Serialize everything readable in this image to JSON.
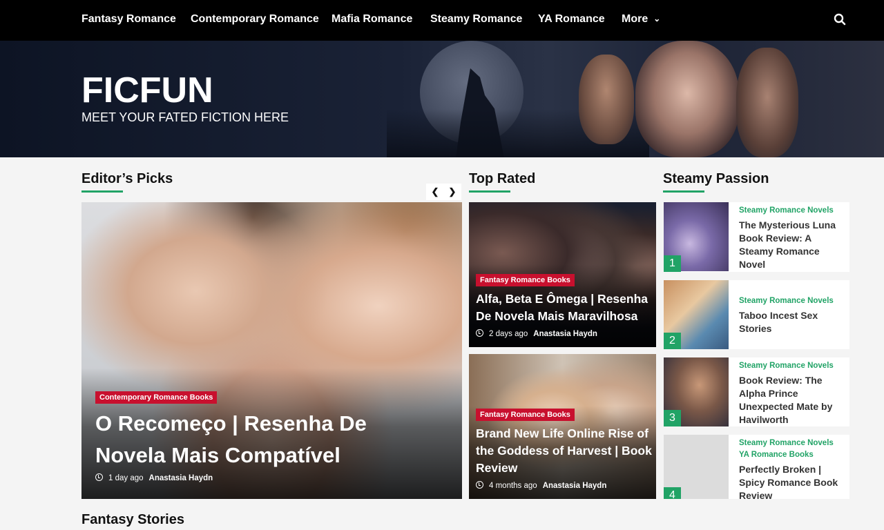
{
  "nav": {
    "items": [
      "Fantasy Romance",
      "Contemporary Romance",
      "Mafia Romance",
      "Steamy Romance",
      "YA Romance"
    ],
    "more_label": "More"
  },
  "hero": {
    "title": "FICFUN",
    "tagline": "MEET YOUR FATED FICTION HERE"
  },
  "editors_picks": {
    "heading": "Editor’s Picks",
    "card": {
      "category": "Contemporary Romance Books",
      "title": "O Recomeço | Resenha De Novela Mais Compatível",
      "time": "1 day ago",
      "author": "Anastasia Haydn"
    }
  },
  "top_rated": {
    "heading": "Top Rated",
    "cards": [
      {
        "category": "Fantasy Romance Books",
        "title": "Alfa, Beta E Ômega | Resenha De Novela Mais Maravilhosa",
        "time": "2 days ago",
        "author": "Anastasia Haydn"
      },
      {
        "category": "Fantasy Romance Books",
        "title": "Brand New Life Online Rise of the Goddess of Harvest | Book Review",
        "time": "4 months ago",
        "author": "Anastasia Haydn"
      }
    ]
  },
  "steamy_passion": {
    "heading": "Steamy Passion",
    "items": [
      {
        "rank": "1",
        "categories": [
          "Steamy Romance Novels"
        ],
        "title": "The Mysterious Luna Book Review: A Steamy Romance Novel"
      },
      {
        "rank": "2",
        "categories": [
          "Steamy Romance Novels"
        ],
        "title": "Taboo Incest Sex Stories"
      },
      {
        "rank": "3",
        "categories": [
          "Steamy Romance Novels"
        ],
        "title": "Book Review: The Alpha Prince Unexpected Mate by Havilworth"
      },
      {
        "rank": "4",
        "categories": [
          "Steamy Romance Novels",
          "YA Romance Books"
        ],
        "title": "Perfectly Broken | Spicy Romance Book Review"
      }
    ]
  },
  "fantasy_stories": {
    "heading": "Fantasy Stories"
  },
  "colors": {
    "accent": "#21a366",
    "badge": "#c8102e",
    "nav_bg": "#000000"
  }
}
